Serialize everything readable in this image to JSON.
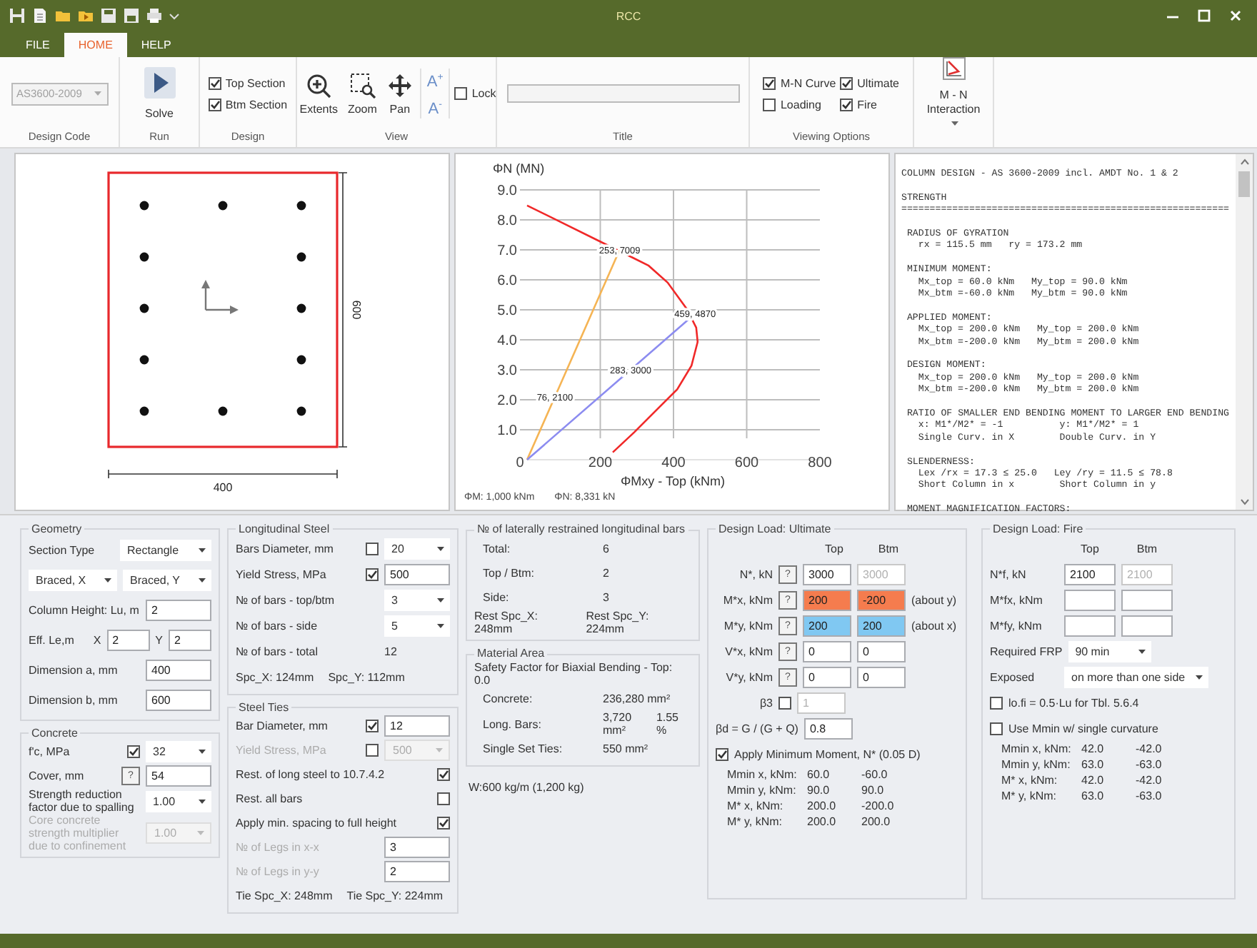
{
  "window": {
    "title": "RCC"
  },
  "menu_tabs": [
    {
      "label": "FILE",
      "selected": false
    },
    {
      "label": "HOME",
      "selected": true
    },
    {
      "label": "HELP",
      "selected": false
    }
  ],
  "ribbon": [
    {
      "label": "Design Code",
      "items": [
        {
          "kind": "dropdown",
          "value": "AS3600-2009",
          "disabled": true
        }
      ]
    },
    {
      "label": "Run",
      "items": [
        {
          "kind": "big",
          "label": "Solve"
        }
      ]
    },
    {
      "label": "Design",
      "items": [
        {
          "kind": "checks",
          "checks": [
            {
              "label": "Top Section",
              "checked": true
            },
            {
              "label": "Btm Section",
              "checked": true
            }
          ]
        }
      ]
    },
    {
      "label": "View",
      "items": [
        {
          "kind": "tool",
          "label": "Extents"
        },
        {
          "kind": "tool",
          "label": "Zoom"
        },
        {
          "kind": "tool",
          "label": "Pan"
        },
        {
          "kind": "font",
          "glyphs": [
            "A$^{+}$",
            "A$^{-}$"
          ]
        },
        {
          "kind": "checks",
          "checks": [
            {
              "label": "Lock",
              "checked": false
            }
          ]
        }
      ]
    },
    {
      "label": "Title",
      "items": [
        {
          "kind": "textbox"
        }
      ]
    },
    {
      "label": "Viewing Options",
      "items": [
        {
          "kind": "checks",
          "checks": [
            {
              "label": "M-N Curve",
              "checked": true
            },
            {
              "label": "Loading",
              "checked": false
            }
          ]
        },
        {
          "kind": "checks",
          "checks": [
            {
              "label": "Ultimate",
              "checked": true
            },
            {
              "label": "Fire",
              "checked": true
            }
          ]
        }
      ]
    },
    {
      "items": [
        {
          "kind": "big",
          "label": "M - N Interaction",
          "menu": true
        }
      ]
    }
  ],
  "section_view": {
    "dimension_labels": [
      "600",
      "400"
    ]
  },
  "chart": {
    "chart_data": {
      "type": "line",
      "xlabel": "ΦMxy - Top (kNm)",
      "ylabel": "ΦN (MN)",
      "xlim": [
        0,
        800
      ],
      "ylim": [
        0,
        9
      ],
      "grid": true,
      "xticks": [
        0,
        200,
        400,
        600,
        800
      ],
      "yticks": [
        {
          "value": 1,
          "label": "1.0"
        },
        {
          "value": 2,
          "label": "2.0"
        },
        {
          "value": 3,
          "label": "3.0"
        },
        {
          "value": 4,
          "label": "4.0"
        },
        {
          "value": 5,
          "label": "5.0"
        },
        {
          "value": 6,
          "label": "6.0"
        },
        {
          "value": 7,
          "label": "7.0"
        },
        {
          "value": 8,
          "label": "8.0"
        },
        {
          "value": 9,
          "label": "9.0"
        }
      ],
      "series": [
        {
          "color": "#f02828",
          "x": [
            0,
            202,
            277,
            332,
            384,
            436,
            462,
            466,
            449,
            410,
            358,
            293,
            234
          ],
          "values": [
            8.48,
            7.26,
            6.81,
            6.47,
            5.91,
            5.04,
            4.41,
            3.93,
            3.14,
            2.35,
            1.71,
            0.92,
            0.25
          ]
        },
        {
          "color": "#f5b454",
          "x": [
            0,
            76,
            253
          ],
          "values": [
            0,
            2.1,
            7.0
          ]
        },
        {
          "color": "#8c8cf0",
          "x": [
            0,
            283,
            459
          ],
          "values": [
            0,
            3.0,
            4.87
          ]
        }
      ],
      "annotations": [
        {
          "x": 253,
          "y": 7.0,
          "text": "253, 7009"
        },
        {
          "x": 459,
          "y": 4.87,
          "text": "459, 4870"
        },
        {
          "x": 283,
          "y": 3.0,
          "text": "283, 3000"
        },
        {
          "x": 76,
          "y": 2.1,
          "text": "76, 2100"
        }
      ]
    },
    "footer": [
      "ΦM: 1,000 kNm",
      "ΦN: 8,331 kN"
    ]
  },
  "report": {
    "blocks": [
      {
        "kind": "plain",
        "lines": [
          "COLUMN DESIGN - AS 3600-2009 incl. AMDT No. 1 & 2"
        ]
      },
      {
        "kind": "plain",
        "lines": [
          "STRENGTH",
          "=========================================================="
        ]
      },
      {
        "kind": "section",
        "heading": "RADIUS OF GYRATION",
        "lines": [
          "rx = 115.5 mm   ry = 173.2 mm"
        ]
      },
      {
        "kind": "section",
        "heading": "MINIMUM MOMENT:",
        "lines": [
          "Mx_top = 60.0 kNm   My_top = 90.0 kNm",
          "Mx_btm =-60.0 kNm   My_btm = 90.0 kNm"
        ]
      },
      {
        "kind": "section",
        "heading": "APPLIED MOMENT:",
        "lines": [
          "Mx_top = 200.0 kNm   My_top = 200.0 kNm",
          "Mx_btm =-200.0 kNm   My_btm = 200.0 kNm"
        ]
      },
      {
        "kind": "section",
        "heading": "DESIGN MOMENT:",
        "lines": [
          "Mx_top = 200.0 kNm   My_top = 200.0 kNm",
          "Mx_btm =-200.0 kNm   My_btm = 200.0 kNm"
        ]
      },
      {
        "kind": "section",
        "heading": "RATIO OF SMALLER END BENDING MOMENT TO LARGER END BENDING",
        "lines": [
          "x: M1*/M2* = -1          y: M1*/M2* = 1",
          "Single Curv. in X        Double Curv. in Y"
        ]
      },
      {
        "kind": "section",
        "heading": "SLENDERNESS:",
        "lines": [
          "Lex /rx = 17.3 ≤ 25.0   Ley /ry = 11.5 ≤ 78.8",
          "Short Column in x        Short Column in y"
        ]
      },
      {
        "kind": "section",
        "heading": "MOMENT MAGNIFICATION FACTORS:"
      }
    ]
  },
  "panel": {
    "columns": [
      {
        "groups": [
          {
            "kind": "form",
            "title": "Geometry",
            "rows": [
              {
                "label": "Section Type",
                "disabled": false,
                "controls": [
                  {
                    "kind": "dropdown",
                    "value": "Rectangle",
                    "disabled": false
                  }
                ]
              },
              {
                "controls": [
                  {
                    "kind": "dropdown",
                    "value": "Braced, X",
                    "disabled": false
                  },
                  {
                    "kind": "dropdown",
                    "value": "Braced, Y",
                    "disabled": false
                  }
                ]
              },
              {
                "label": "Column Height: Lu, m",
                "disabled": false,
                "controls": [
                  {
                    "kind": "field",
                    "value": "2",
                    "disabled": false
                  }
                ]
              },
              {
                "label": "Eff. Le,m",
                "disabled": false,
                "controls": [
                  {
                    "kind": "field",
                    "prefix": "X",
                    "value": "2",
                    "disabled": false
                  },
                  {
                    "kind": "field",
                    "prefix": "Y",
                    "value": "2",
                    "disabled": false
                  }
                ]
              },
              {
                "label": "Dimension a, mm",
                "disabled": false,
                "controls": [
                  {
                    "kind": "field",
                    "value": "400",
                    "disabled": false
                  }
                ]
              },
              {
                "label": "Dimension b, mm",
                "disabled": false,
                "controls": [
                  {
                    "kind": "field",
                    "value": "600",
                    "disabled": false
                  }
                ]
              }
            ]
          },
          {
            "kind": "form",
            "title": "Concrete",
            "rows": [
              {
                "label": "f'c, MPa",
                "disabled": false,
                "check": {
                  "checked": true
                },
                "controls": [
                  {
                    "kind": "dropdown",
                    "value": "32",
                    "disabled": false
                  }
                ]
              },
              {
                "label": "Cover, mm",
                "disabled": false,
                "help": "?",
                "controls": [
                  {
                    "kind": "field",
                    "value": "54",
                    "disabled": false
                  }
                ]
              },
              {
                "label": "Strength reduction factor due to spalling",
                "disabled": false,
                "controls": [
                  {
                    "kind": "dropdown",
                    "value": "1.00",
                    "disabled": false
                  }
                ]
              },
              {
                "label": "Core concrete strength multiplier due to confinement",
                "disabled": true,
                "controls": [
                  {
                    "kind": "dropdown",
                    "value": "1.00",
                    "disabled": true
                  }
                ]
              }
            ]
          }
        ]
      },
      {
        "groups": [
          {
            "kind": "form",
            "title": "Longitudinal Steel",
            "rows": [
              {
                "label": "Bars Diameter, mm",
                "disabled": false,
                "check": {
                  "checked": false
                },
                "controls": [
                  {
                    "kind": "dropdown",
                    "value": "20",
                    "disabled": false
                  }
                ]
              },
              {
                "label": "Yield Stress, MPa",
                "disabled": false,
                "check": {
                  "checked": true
                },
                "controls": [
                  {
                    "kind": "field",
                    "value": "500",
                    "disabled": false
                  }
                ]
              },
              {
                "label": "№ of bars - top/btm",
                "disabled": false,
                "controls": [
                  {
                    "kind": "dropdown",
                    "value": "3",
                    "disabled": false
                  }
                ]
              },
              {
                "label": "№ of bars - side",
                "disabled": false,
                "controls": [
                  {
                    "kind": "dropdown",
                    "value": "5",
                    "disabled": false
                  }
                ]
              },
              {
                "label": "№ of bars - total",
                "disabled": false,
                "texts": [
                  "12"
                ]
              },
              {
                "texts": [
                  "Spc_X: 124mm",
                  "Spc_Y: 112mm"
                ]
              }
            ]
          },
          {
            "kind": "form",
            "title": "Steel Ties",
            "rows": [
              {
                "label": "Bar Diameter, mm",
                "disabled": false,
                "check": {
                  "checked": true
                },
                "controls": [
                  {
                    "kind": "field",
                    "value": "12",
                    "disabled": false
                  }
                ]
              },
              {
                "label": "Yield Stress, MPa",
                "disabled": true,
                "check": {
                  "checked": false
                },
                "controls": [
                  {
                    "kind": "dropdown",
                    "value": "500",
                    "disabled": true
                  }
                ]
              },
              {
                "label": "Rest. of long steel to 10.7.4.2",
                "disabled": false,
                "check": {
                  "checked": true
                }
              },
              {
                "label": "Rest. all bars",
                "disabled": false,
                "check": {
                  "checked": false
                }
              },
              {
                "label": "Apply min. spacing to full height",
                "disabled": false,
                "check": {
                  "checked": true
                }
              },
              {
                "label": "№ of Legs in x-x",
                "disabled": true,
                "controls": [
                  {
                    "kind": "field",
                    "value": "3",
                    "disabled": false
                  }
                ]
              },
              {
                "label": "№ of Legs in y-y",
                "disabled": true,
                "controls": [
                  {
                    "kind": "field",
                    "value": "2",
                    "disabled": false
                  }
                ]
              },
              {
                "texts": [
                  "Tie Spc_X: 248mm",
                  "Tie Spc_Y: 224mm"
                ]
              }
            ]
          }
        ]
      },
      {
        "groups": [
          {
            "kind": "stats",
            "title": "№ of laterally restrained longitudinal bars",
            "rows": [
              {
                "label": "Total:",
                "disabled": false,
                "texts": [
                  "6"
                ]
              },
              {
                "label": "Top / Btm:",
                "disabled": false,
                "texts": [
                  "2"
                ]
              },
              {
                "label": "Side:",
                "disabled": false,
                "texts": [
                  "3"
                ]
              },
              {
                "texts": [
                  "Rest Spc_X: 248mm",
                  "Rest Spc_Y: 224mm"
                ]
              }
            ]
          },
          {
            "kind": "stats",
            "title": "Material Area",
            "rows": [
              {
                "texts": [
                  "Safety Factor for Biaxial Bending - Top: 0.0"
                ]
              },
              {
                "label": "Concrete:",
                "disabled": false,
                "texts": [
                  "236,280 mm²"
                ]
              },
              {
                "label": "Long. Bars:",
                "disabled": false,
                "texts": [
                  "3,720 mm²",
                  "1.55 %"
                ]
              },
              {
                "label": "Single Set Ties:",
                "disabled": false,
                "texts": [
                  "550 mm²"
                ]
              }
            ]
          },
          {
            "kind": "plain",
            "rows": [
              {
                "texts": [
                  "W:600 kg/m (1,200 kg)"
                ]
              }
            ]
          }
        ]
      },
      {
        "groups": [
          {
            "kind": "loads",
            "title": "Design Load: Ultimate",
            "rows": [
              {
                "headers": [
                  "Top",
                  "Btm"
                ]
              },
              {
                "label": "N*, kN",
                "disabled": false,
                "help": "?",
                "controls": [
                  {
                    "kind": "field",
                    "value": "3000",
                    "disabled": false
                  },
                  {
                    "kind": "field",
                    "value": "3000",
                    "disabled": true
                  }
                ]
              },
              {
                "label": "M*x, kNm",
                "disabled": false,
                "help": "?",
                "controls": [
                  {
                    "kind": "field",
                    "value": "200",
                    "disabled": false,
                    "color": "#f57c4e"
                  },
                  {
                    "kind": "field",
                    "value": "-200",
                    "disabled": false,
                    "color": "#f57c4e"
                  }
                ],
                "note": "(about y)"
              },
              {
                "label": "M*y, kNm",
                "disabled": false,
                "help": "?",
                "controls": [
                  {
                    "kind": "field",
                    "value": "200",
                    "disabled": false,
                    "color": "#80c8f2"
                  },
                  {
                    "kind": "field",
                    "value": "200",
                    "disabled": false,
                    "color": "#80c8f2"
                  }
                ],
                "note": "(about x)"
              },
              {
                "label": "V*x, kNm",
                "disabled": false,
                "help": "?",
                "controls": [
                  {
                    "kind": "field",
                    "value": "0",
                    "disabled": false
                  },
                  {
                    "kind": "field",
                    "value": "0",
                    "disabled": false
                  }
                ]
              },
              {
                "label": "V*y, kNm",
                "disabled": false,
                "help": "?",
                "controls": [
                  {
                    "kind": "field",
                    "value": "0",
                    "disabled": false
                  },
                  {
                    "kind": "field",
                    "value": "0",
                    "disabled": false
                  }
                ]
              },
              {
                "label": "β3",
                "disabled": false,
                "check": {
                  "checked": false
                },
                "controls": [
                  {
                    "kind": "field",
                    "value": "1",
                    "disabled": true
                  }
                ]
              },
              {
                "label": "βd = G / (G + Q)",
                "disabled": false,
                "controls": [
                  {
                    "kind": "field",
                    "value": "0.8",
                    "disabled": false
                  }
                ]
              },
              {
                "option": {
                  "label": "Apply Minimum Moment, N* (0.05 D)",
                  "checked": true
                }
              },
              {
                "texts": [
                  "Mmin x, kNm:",
                  "60.0",
                  "-60.0"
                ]
              },
              {
                "texts": [
                  "Mmin y, kNm:",
                  "90.0",
                  "90.0"
                ]
              },
              {
                "texts": [
                  "M* x, kNm:",
                  "200.0",
                  "-200.0"
                ]
              },
              {
                "texts": [
                  "M* y, kNm:",
                  "200.0",
                  "200.0"
                ]
              }
            ]
          }
        ]
      },
      {
        "groups": [
          {
            "kind": "fire",
            "title": "Design Load: Fire",
            "rows": [
              {
                "headers": [
                  "Top",
                  "Btm"
                ]
              },
              {
                "label": "N*f, kN",
                "disabled": false,
                "controls": [
                  {
                    "kind": "field",
                    "value": "2100",
                    "disabled": false
                  },
                  {
                    "kind": "field",
                    "value": "2100",
                    "disabled": true
                  }
                ]
              },
              {
                "label": "M*fx, kNm",
                "disabled": false,
                "controls": [
                  {
                    "kind": "field",
                    "disabled": false
                  },
                  {
                    "kind": "field",
                    "disabled": false
                  }
                ]
              },
              {
                "label": "M*fy, kNm",
                "disabled": false,
                "controls": [
                  {
                    "kind": "field",
                    "disabled": false
                  },
                  {
                    "kind": "field",
                    "disabled": false
                  }
                ]
              },
              {
                "label": "Required FRP",
                "disabled": false,
                "controls": [
                  {
                    "kind": "dropdown",
                    "value": "90 min",
                    "disabled": false
                  }
                ]
              },
              {
                "label": "Exposed",
                "disabled": false,
                "controls": [
                  {
                    "kind": "dropdown",
                    "value": "on more than one side",
                    "disabled": false
                  }
                ]
              },
              {
                "option": {
                  "label": "lo.fi = 0.5·Lu for Tbl. 5.6.4",
                  "checked": false
                }
              },
              {
                "option": {
                  "label": "Use Mmin w/ single curvature",
                  "checked": false
                }
              },
              {
                "texts": [
                  "Mmin x, kNm:",
                  "42.0",
                  "-42.0"
                ]
              },
              {
                "texts": [
                  "Mmin y, kNm:",
                  "63.0",
                  "-63.0"
                ]
              },
              {
                "texts": [
                  "M* x, kNm:",
                  "42.0",
                  "-42.0"
                ]
              },
              {
                "texts": [
                  "M* y, kNm:",
                  "63.0",
                  "-63.0"
                ]
              }
            ]
          }
        ]
      }
    ]
  }
}
